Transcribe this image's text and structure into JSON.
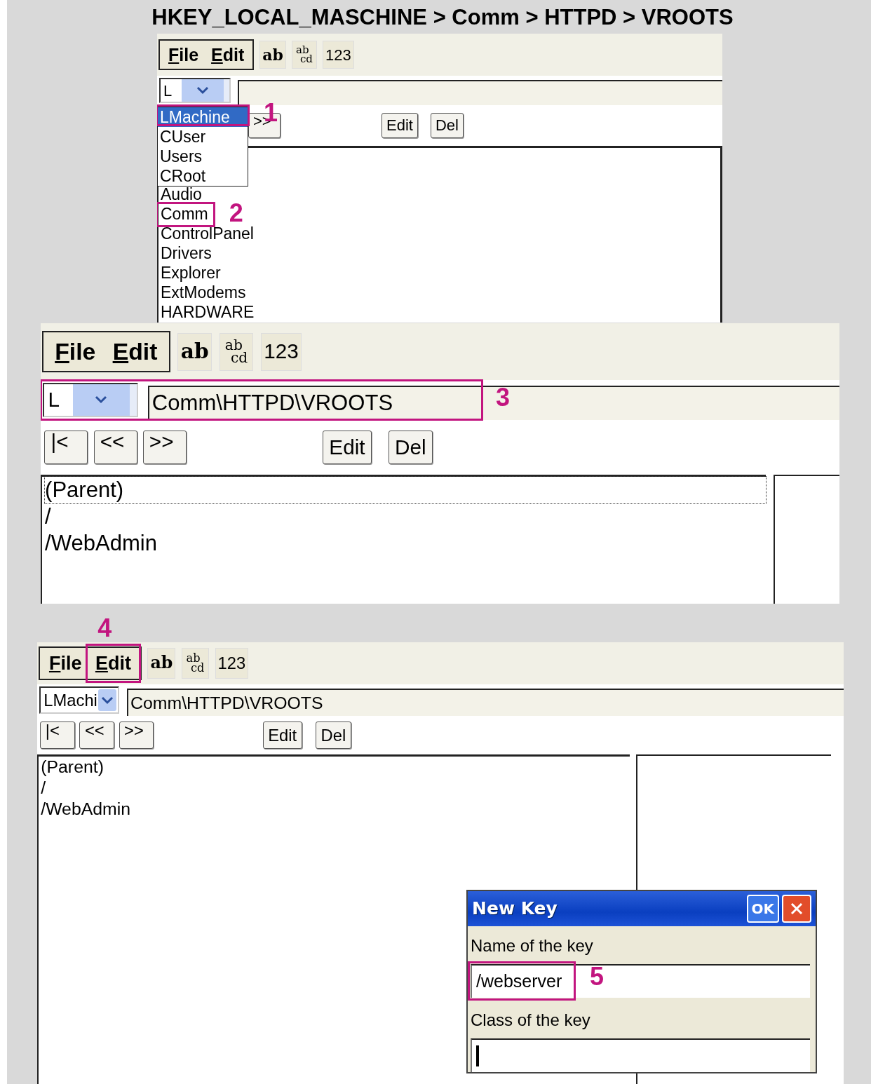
{
  "heading": "HKEY_LOCAL_MASCHINE > Comm > HTTPD > VROOTS",
  "panels": [
    {
      "menu": [
        {
          "label": "File"
        },
        {
          "label": "Edit"
        }
      ],
      "toolbar": [
        {
          "kind": "bold",
          "label": "ab"
        },
        {
          "kind": "stacked",
          "top": "ab",
          "bottom": "cd"
        },
        {
          "kind": "plain",
          "label": "123"
        }
      ],
      "address": {
        "combo": "L"
      },
      "dropdown": [
        {
          "label": "LMachine",
          "selected": true,
          "annotation": "1"
        },
        {
          "label": "CUser",
          "selected": false
        },
        {
          "label": "Users",
          "selected": false
        },
        {
          "label": "CRoot",
          "selected": false
        }
      ],
      "nav_buttons": [
        ">>"
      ],
      "action_buttons": [
        "Edit",
        "Del"
      ],
      "keys": [
        {
          "label": "Audio"
        },
        {
          "label": "Comm",
          "annotation": "2"
        },
        {
          "label": "ControlPanel"
        },
        {
          "label": "Drivers"
        },
        {
          "label": "Explorer"
        },
        {
          "label": "ExtModems"
        },
        {
          "label": "HARDWARE"
        }
      ]
    },
    {
      "menu": [
        {
          "label": "File"
        },
        {
          "label": "Edit"
        }
      ],
      "toolbar": [
        {
          "kind": "bold",
          "label": "ab"
        },
        {
          "kind": "stacked",
          "top": "ab",
          "bottom": "cd"
        },
        {
          "kind": "plain",
          "label": "123"
        }
      ],
      "address": {
        "combo": "L",
        "path": "Comm\\HTTPD\\VROOTS",
        "annotation": "3"
      },
      "nav_buttons": [
        "|<",
        "<<",
        ">>"
      ],
      "action_buttons": [
        "Edit",
        "Del"
      ],
      "keys": [
        {
          "label": "(Parent)",
          "focused": true
        },
        {
          "label": "/",
          "focused": false
        },
        {
          "label": "/WebAdmin",
          "focused": false
        }
      ],
      "value_pane": true
    },
    {
      "menu": [
        {
          "label": "File"
        },
        {
          "label": "Edit",
          "annotation": "4"
        }
      ],
      "toolbar": [
        {
          "kind": "bold",
          "label": "ab"
        },
        {
          "kind": "stacked",
          "top": "ab",
          "bottom": "cd"
        },
        {
          "kind": "plain",
          "label": "123"
        }
      ],
      "address": {
        "combo": "LMachi",
        "path": "Comm\\HTTPD\\VROOTS"
      },
      "nav_buttons": [
        "|<",
        "<<",
        ">>"
      ],
      "action_buttons": [
        "Edit",
        "Del"
      ],
      "keys": [
        {
          "label": "(Parent)"
        },
        {
          "label": "/"
        },
        {
          "label": "/WebAdmin"
        }
      ],
      "value_pane": true,
      "dialog": {
        "title": "New Key",
        "ok": "OK",
        "fields": [
          {
            "label": "Name of the key",
            "value": "/webserver",
            "caret": false,
            "annotation": "5"
          },
          {
            "label": "Class of the key",
            "caret": true
          }
        ]
      }
    }
  ]
}
